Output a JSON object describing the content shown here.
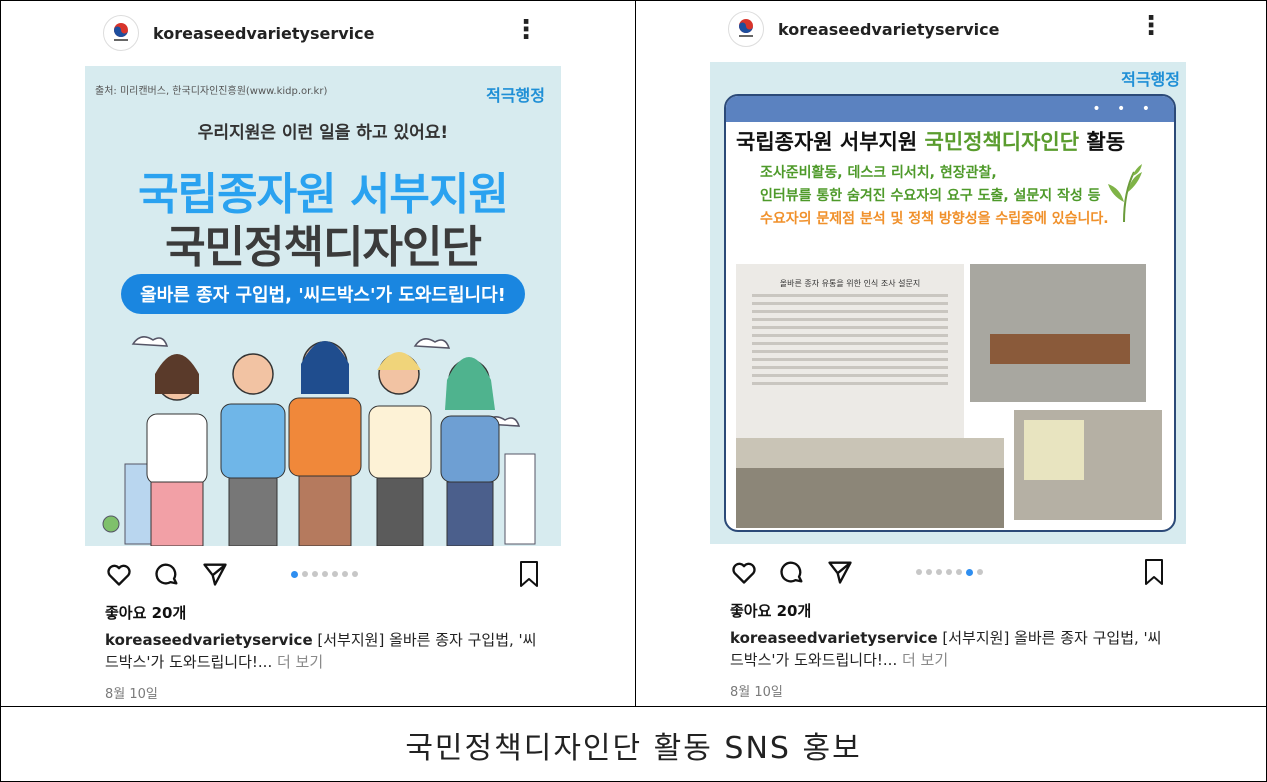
{
  "caption": "국민정책디자인단 활동 SNS 홍보",
  "posts": [
    {
      "username": "koreaseedvarietyservice",
      "image": {
        "credit": "출처: 미리캔버스, 한국디자인진흥원(www.kidp.or.kr)",
        "tag": "적극행정",
        "subhead": "우리지원은 이런 일을 하고 있어요!",
        "title_line1": "국립종자원 서부지원",
        "title_line2": "국민정책디자인단",
        "banner": "올바른 종자 구입법, '씨드박스'가 도와드립니다!"
      },
      "likes": "좋아요 20개",
      "desc_user": "koreaseedvarietyservice",
      "desc_text": " [서부지원] 올바른 종자 구입법, '씨드박스'가 도와드립니다!...",
      "more": " 더 보기",
      "date": "8월 10일",
      "carousel_active": 0,
      "carousel_count": 7
    },
    {
      "username": "koreaseedvarietyservice",
      "image": {
        "tag": "적극행정",
        "title_part1": "국립종자원 서부지원 ",
        "title_green": "국민정책디자인단",
        "title_part2": " 활동",
        "line1": "조사준비활동, 데스크 리서치, 현장관찰,",
        "line2": "인터뷰를 통한 숨겨진 수요자의 요구 도출, 설문지 작성 등",
        "line3": "수요자의 문제점 분석 및 정책 방향성을 수립중에 있습니다.",
        "survey_title": "올바른 종자 유통을 위한 인식 조사 설문지",
        "bar_dots": "• • •"
      },
      "likes": "좋아요 20개",
      "desc_user": "koreaseedvarietyservice",
      "desc_text": " [서부지원] 올바른 종자 구입법, '씨드박스'가 도와드립니다!...",
      "more": " 더 보기",
      "date": "8월 10일",
      "carousel_active": 5,
      "carousel_count": 7
    }
  ],
  "icons": {
    "like": "heart-icon",
    "comment": "comment-icon",
    "share": "send-icon",
    "save": "bookmark-icon",
    "more": "more-vertical-icon"
  },
  "colors": {
    "accent_blue": "#1a86e0",
    "title_blue": "#2aa2f0",
    "green": "#5a9c2e",
    "orange": "#f0902a",
    "carousel_active": "#2e8ef0"
  }
}
